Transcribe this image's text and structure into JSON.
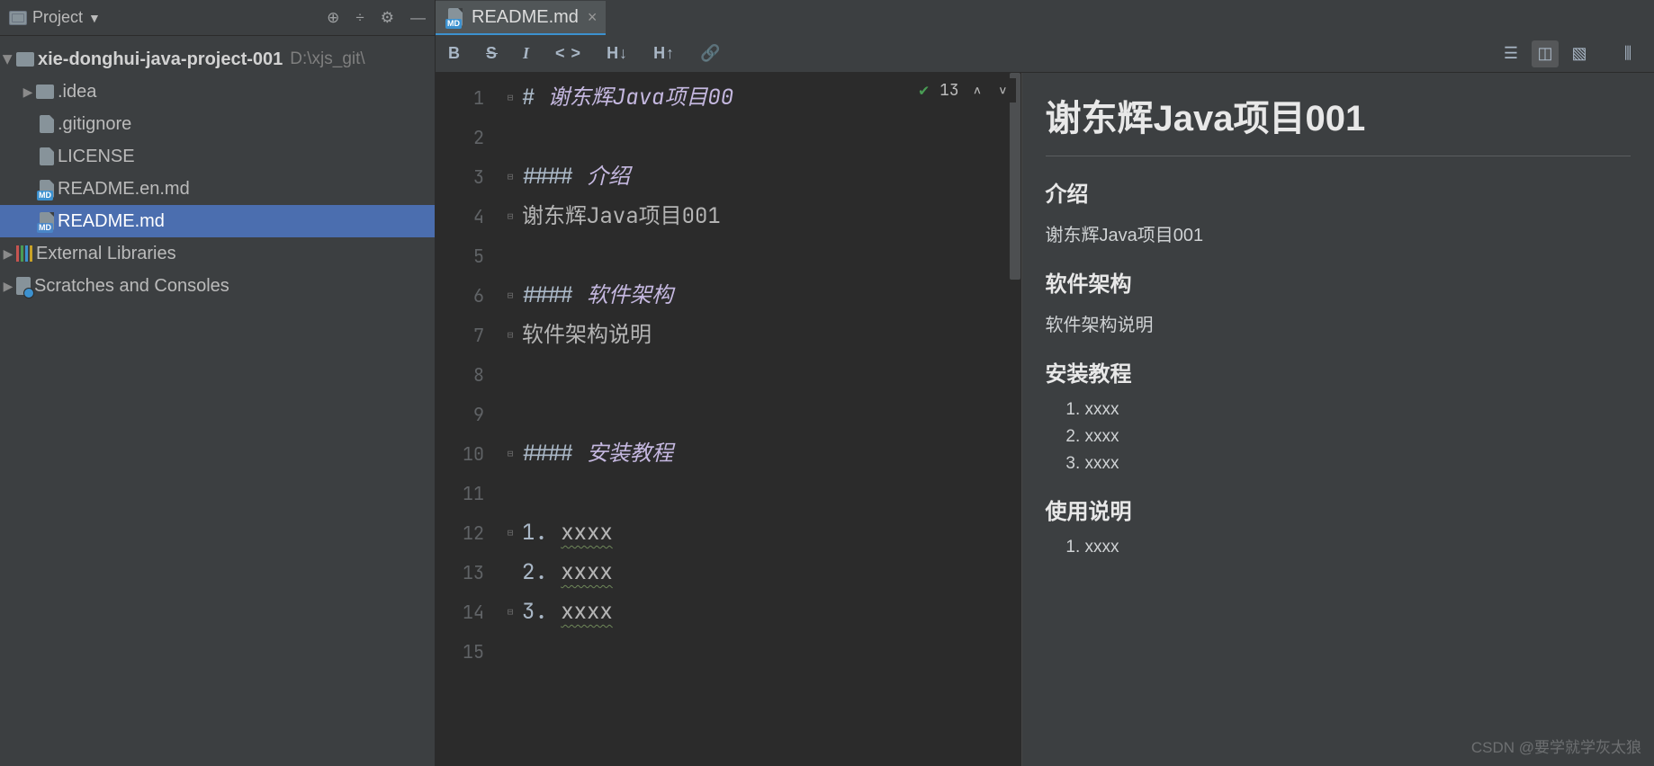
{
  "sidebar": {
    "title": "Project",
    "root": {
      "name": "xie-donghui-java-project-001",
      "path": "D:\\xjs_git\\"
    },
    "items": [
      {
        "label": ".idea"
      },
      {
        "label": ".gitignore"
      },
      {
        "label": "LICENSE"
      },
      {
        "label": "README.en.md"
      },
      {
        "label": "README.md"
      }
    ],
    "external": "External Libraries",
    "scratch": "Scratches and Consoles"
  },
  "tab": {
    "label": "README.md",
    "badge": "MD"
  },
  "md_toolbar": {
    "bold": "B",
    "strike": "S",
    "italic": "I",
    "code": "< >",
    "hdec": "H↓",
    "hinc": "H↑",
    "link": "🔗"
  },
  "lint": {
    "count": "13"
  },
  "lines": [
    "1",
    "2",
    "3",
    "4",
    "5",
    "6",
    "7",
    "8",
    "9",
    "10",
    "11",
    "12",
    "13",
    "14",
    "15"
  ],
  "code": {
    "l1_punct": "# ",
    "l1": "谢东辉Java项目00",
    "l3_punct": "#### ",
    "l3": "介绍",
    "l4": "谢东辉Java项目001",
    "l6_punct": "#### ",
    "l6": "软件架构",
    "l7": "软件架构说明",
    "l10_punct": "#### ",
    "l10": "安装教程",
    "l12_num": "1. ",
    "l12": "xxxx",
    "l13_num": "2. ",
    "l13": "xxxx",
    "l14_num": "3. ",
    "l14": "xxxx"
  },
  "preview": {
    "h1": "谢东辉Java项目001",
    "sections": [
      {
        "h": "介绍",
        "p": "谢东辉Java项目001"
      },
      {
        "h": "软件架构",
        "p": "软件架构说明"
      },
      {
        "h": "安装教程",
        "items": [
          "xxxx",
          "xxxx",
          "xxxx"
        ]
      },
      {
        "h": "使用说明",
        "items_partial": [
          "xxxx"
        ]
      }
    ]
  },
  "watermark": "CSDN @要学就学灰太狼"
}
